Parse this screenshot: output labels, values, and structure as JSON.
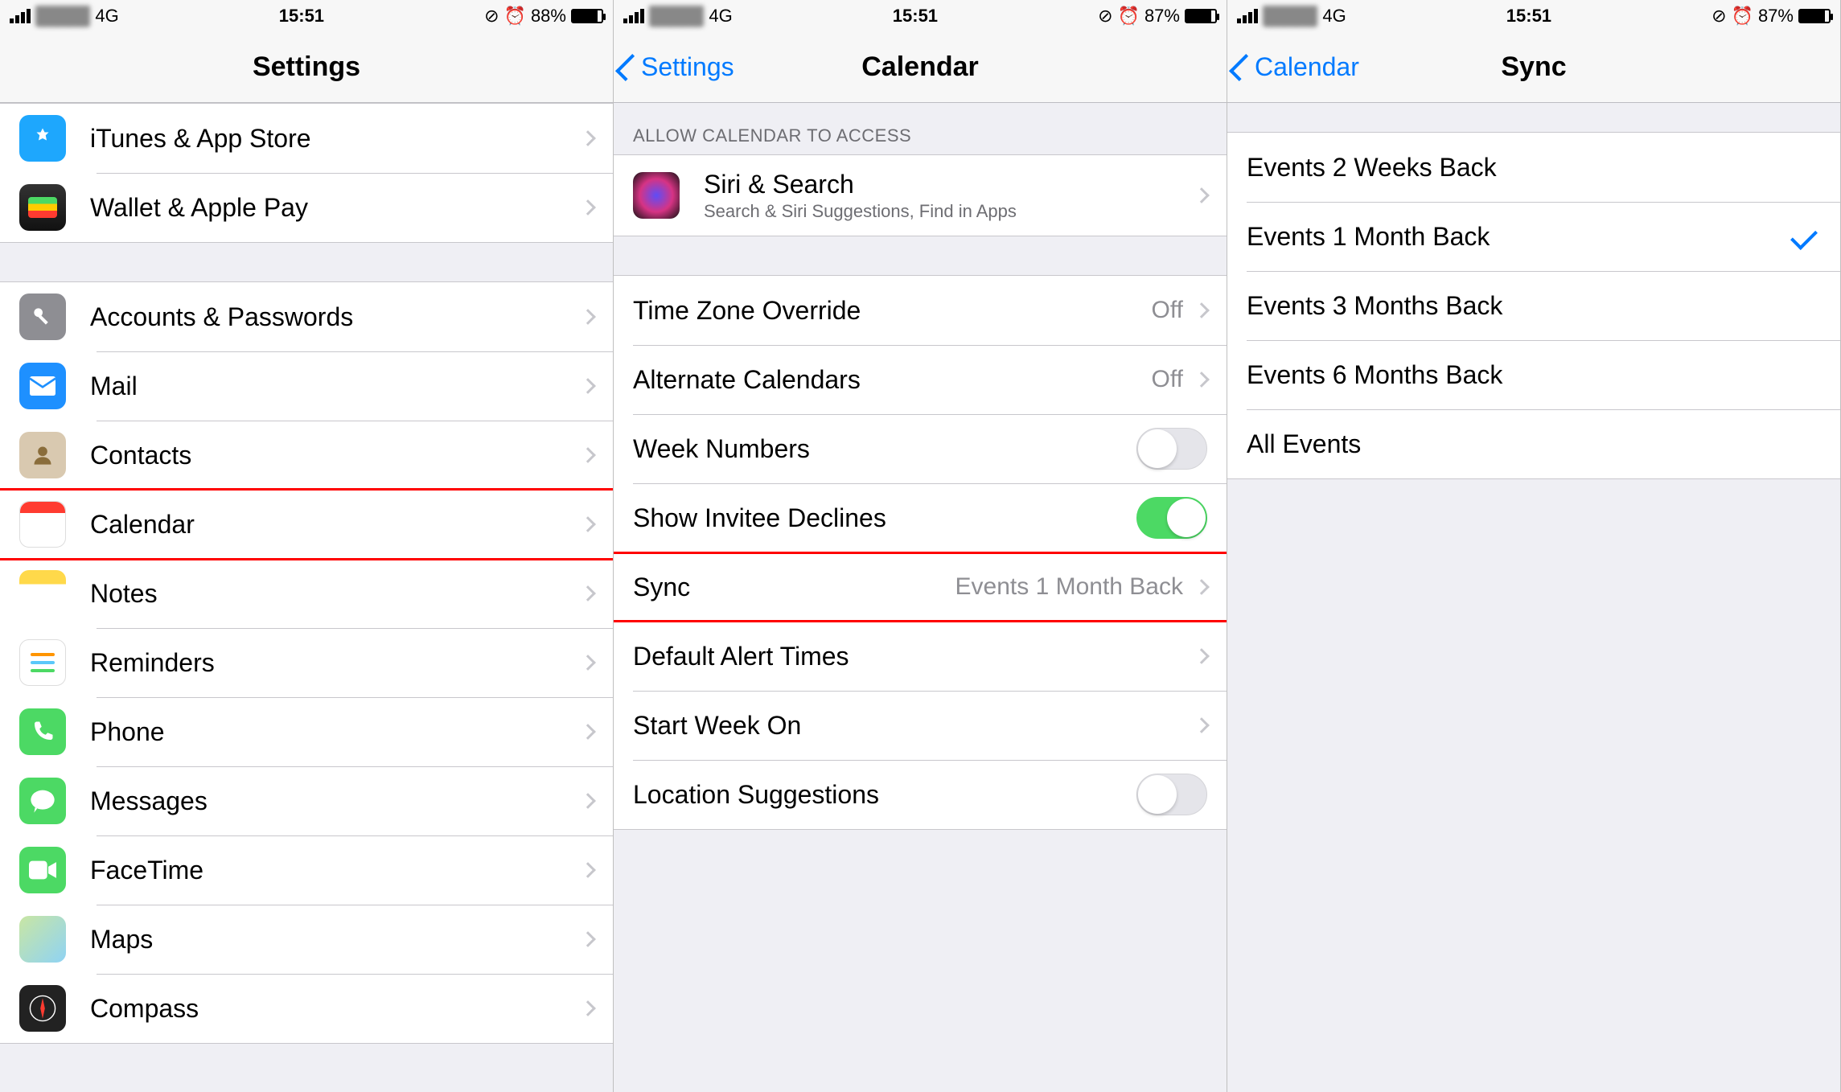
{
  "status": {
    "carrier": "████",
    "network": "4G",
    "time1": "15:51",
    "time2": "15:51",
    "time3": "15:51",
    "battery1": "88%",
    "battery2": "87%",
    "battery3": "87%"
  },
  "screen1": {
    "title": "Settings",
    "group1": [
      {
        "icon": "appstore-icon",
        "label": "iTunes & App Store"
      },
      {
        "icon": "wallet-icon",
        "label": "Wallet & Apple Pay"
      }
    ],
    "group2": [
      {
        "icon": "key-icon",
        "label": "Accounts & Passwords"
      },
      {
        "icon": "mail-icon",
        "label": "Mail"
      },
      {
        "icon": "contacts-icon",
        "label": "Contacts"
      },
      {
        "icon": "calendar-icon",
        "label": "Calendar",
        "highlight": true
      },
      {
        "icon": "notes-icon",
        "label": "Notes"
      },
      {
        "icon": "reminders-icon",
        "label": "Reminders"
      },
      {
        "icon": "phone-icon",
        "label": "Phone"
      },
      {
        "icon": "messages-icon",
        "label": "Messages"
      },
      {
        "icon": "facetime-icon",
        "label": "FaceTime"
      },
      {
        "icon": "maps-icon",
        "label": "Maps"
      },
      {
        "icon": "compass-icon",
        "label": "Compass"
      }
    ]
  },
  "screen2": {
    "back": "Settings",
    "title": "Calendar",
    "sectionHeader": "Allow Calendar to Access",
    "siri": {
      "title": "Siri & Search",
      "sub": "Search & Siri Suggestions, Find in Apps"
    },
    "rows": {
      "tz": {
        "label": "Time Zone Override",
        "value": "Off"
      },
      "alt": {
        "label": "Alternate Calendars",
        "value": "Off"
      },
      "wn": {
        "label": "Week Numbers"
      },
      "sid": {
        "label": "Show Invitee Declines"
      },
      "sync": {
        "label": "Sync",
        "value": "Events 1 Month Back"
      },
      "dat": {
        "label": "Default Alert Times"
      },
      "swo": {
        "label": "Start Week On"
      },
      "ls": {
        "label": "Location Suggestions"
      }
    }
  },
  "screen3": {
    "back": "Calendar",
    "title": "Sync",
    "options": [
      {
        "label": "Events 2 Weeks Back",
        "checked": false
      },
      {
        "label": "Events 1 Month Back",
        "checked": true
      },
      {
        "label": "Events 3 Months Back",
        "checked": false
      },
      {
        "label": "Events 6 Months Back",
        "checked": false
      },
      {
        "label": "All Events",
        "checked": false
      }
    ]
  }
}
